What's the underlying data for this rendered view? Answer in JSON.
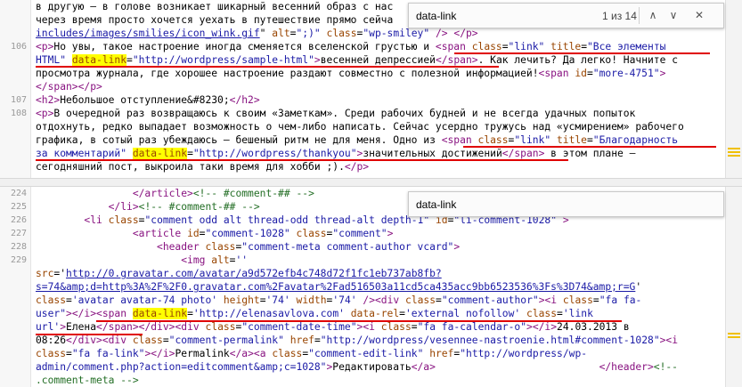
{
  "find_bar": {
    "query": "data-link",
    "count": "1 из 14",
    "prev_glyph": "∧",
    "next_glyph": "∨",
    "close_glyph": "✕"
  },
  "top_pane": {
    "lines": [
      {
        "ln": "",
        "html": "в другую — в голове возникает шикарный весенний образ с нас"
      },
      {
        "ln": "",
        "html": "через время просто хочется уехать в путешествие прямо сейча"
      },
      {
        "ln": "",
        "html": "<span class=\"au\">includes/images/smilies/icon_wink.gif</span>\" <span class=\"an\">alt</span>=<span class=\"av\">\";)\"</span> <span class=\"an\">class</span>=<span class=\"av\">\"wp-smiley\"</span> <span class=\"t\">/&gt; &lt;/p&gt;</span>"
      },
      {
        "ln": "106",
        "html": "<span class=\"t\">&lt;p&gt;</span>Но увы, такое настроение иногда сменяется вселенской грустью и <span class=\"t\">&lt;span</span> <span class=\"an\">class</span>=<span class=\"av\">\"link\"</span> <span class=\"an\">title</span>=<span class=\"av\">\"Все элементы</span>"
      },
      {
        "ln": "",
        "html": "<span class=\"av\">HTML\"</span> <span class=\"an hl\">data-link</span>=<span class=\"av\">\"http://wordpress/sample-html\"</span><span class=\"t\">&gt;</span>весенней депрессией<span class=\"t\">&lt;/span&gt;</span>. Как лечить? Да легко! Начните с"
      },
      {
        "ln": "",
        "html": "просмотра журнала, где хорошее настроение раздают совместно с полезной информацией!<span class=\"t\">&lt;span</span> <span class=\"an\">id</span>=<span class=\"av\">\"more-4751\"</span><span class=\"t\">&gt;</span>"
      },
      {
        "ln": "",
        "html": "<span class=\"t\">&lt;/span&gt;&lt;/p&gt;</span>"
      },
      {
        "ln": "107",
        "html": "<span class=\"t\">&lt;h2&gt;</span>Небольшое отступление&amp;#8230;<span class=\"t\">&lt;/h2&gt;</span>"
      },
      {
        "ln": "108",
        "html": "<span class=\"t\">&lt;p&gt;</span>В очередной раз возвращаюсь к своим «Заметкам». Среди рабочих будней и не всегда удачных попыток"
      },
      {
        "ln": "",
        "html": "отдохнуть, редко выпадает возможность о чем-либо написать. Сейчас усердно тружусь над «усмирением» рабочего"
      },
      {
        "ln": "",
        "html": "графика, в сотый раз убеждаюсь — бешеный ритм не для меня. Одно из <span class=\"t\">&lt;span</span> <span class=\"an\">class</span>=<span class=\"av\">\"link\"</span> <span class=\"an\">title</span>=<span class=\"av\">\"Благодарность</span>"
      },
      {
        "ln": "",
        "html": "<span class=\"av\">за комментарий\"</span> <span class=\"an hl\">data-link</span>=<span class=\"av\">\"http://wordpress/thankyou\"</span><span class=\"t\">&gt;</span>значительных достижений<span class=\"t\">&lt;/span&gt;</span> в этом плане —"
      },
      {
        "ln": "",
        "html": "сегодняшний пост, выкроила таки время для хобби ;).<span class=\"t\">&lt;/p&gt;</span>"
      }
    ]
  },
  "bottom_pane": {
    "lines": [
      {
        "ln": "224",
        "html": "                <span class=\"t\">&lt;/article&gt;</span><span class=\"cm\">&lt;!-- #comment-## --&gt;</span>"
      },
      {
        "ln": "225",
        "html": "            <span class=\"t\">&lt;/li&gt;</span><span class=\"cm\">&lt;!-- #comment-## --&gt;</span>"
      },
      {
        "ln": "226",
        "html": "        <span class=\"t\">&lt;li</span> <span class=\"an\">class</span>=<span class=\"av\">\"comment odd alt thread-odd thread-alt depth-1\"</span> <span class=\"an\">id</span>=<span class=\"av\">\"li-comment-1028\"</span> <span class=\"t\">&gt;</span>"
      },
      {
        "ln": "227",
        "html": "                <span class=\"t\">&lt;article</span> <span class=\"an\">id</span>=<span class=\"av\">\"comment-1028\"</span> <span class=\"an\">class</span>=<span class=\"av\">\"comment\"</span><span class=\"t\">&gt;</span>"
      },
      {
        "ln": "228",
        "html": "                    <span class=\"t\">&lt;header</span> <span class=\"an\">class</span>=<span class=\"av\">\"comment-meta comment-author vcard\"</span><span class=\"t\">&gt;</span>"
      },
      {
        "ln": "229",
        "html": "                        <span class=\"t\">&lt;img</span> <span class=\"an\">alt</span>=<span class=\"av\">''</span>"
      },
      {
        "ln": "",
        "html": "<span class=\"an\">src</span>='<span class=\"au\">http://0.gravatar.com/avatar/a9d572efb4c748d72f1fc1eb737ab8fb?</span>"
      },
      {
        "ln": "",
        "html": "<span class=\"au\">s=74&amp;amp;d=http%3A%2F%2F0.gravatar.com%2Favatar%2Fad516503a11cd5ca435acc9bb6523536%3Fs%3D74&amp;amp;r=G</span>'"
      },
      {
        "ln": "",
        "html": "<span class=\"an\">class</span>=<span class=\"av\">'avatar avatar-74 photo'</span> <span class=\"an\">height</span>=<span class=\"av\">'74'</span> <span class=\"an\">width</span>=<span class=\"av\">'74'</span> <span class=\"t\">/&gt;</span><span class=\"t\">&lt;div</span> <span class=\"an\">class</span>=<span class=\"av\">\"comment-author\"</span><span class=\"t\">&gt;&lt;i</span> <span class=\"an\">class</span>=<span class=\"av\">\"fa fa-</span>"
      },
      {
        "ln": "",
        "html": "<span class=\"av\">user\"</span><span class=\"t\">&gt;&lt;/i&gt;</span><span class=\"t\">&lt;span</span> <span class=\"an hl\">data-link</span>=<span class=\"av\">'http://elenasavlova.com'</span> <span class=\"an\">data-rel</span>=<span class=\"av\">'external nofollow'</span> <span class=\"an\">class</span>=<span class=\"av\">'link</span>"
      },
      {
        "ln": "",
        "html": "<span class=\"av\">url'</span><span class=\"t\">&gt;</span>Елена<span class=\"t\">&lt;/span&gt;</span><span class=\"t\">&lt;/div&gt;&lt;div</span> <span class=\"an\">class</span>=<span class=\"av\">\"comment-date-time\"</span><span class=\"t\">&gt;&lt;i</span> <span class=\"an\">class</span>=<span class=\"av\">\"fa fa-calendar-o\"</span><span class=\"t\">&gt;&lt;/i&gt;</span>24.03.2013 в"
      },
      {
        "ln": "",
        "html": "08:26<span class=\"t\">&lt;/div&gt;&lt;div</span> <span class=\"an\">class</span>=<span class=\"av\">\"comment-permalink\"</span> <span class=\"an\">href</span>=<span class=\"av\">\"http://wordpress/vesennee-nastroenie.html#comment-1028\"</span><span class=\"t\">&gt;&lt;i</span>"
      },
      {
        "ln": "",
        "html": "<span class=\"an\">class</span>=<span class=\"av\">\"fa fa-link\"</span><span class=\"t\">&gt;&lt;/i&gt;</span>Permalink<span class=\"t\">&lt;/a&gt;&lt;a</span> <span class=\"an\">class</span>=<span class=\"av\">\"comment-edit-link\"</span> <span class=\"an\">href</span>=<span class=\"av\">\"http://wordpress/wp-</span>"
      },
      {
        "ln": "",
        "html": "<span class=\"av\">admin/comment.php?action=editcomment&amp;amp;c=1028\"</span><span class=\"t\">&gt;</span>Редактировать<span class=\"t\">&lt;/a&gt;</span>                           <span class=\"t\">&lt;/header&gt;</span><span class=\"cm\">&lt;!--</span>"
      },
      {
        "ln": "",
        "html": "<span class=\"cm\">.comment-meta --&gt;</span>"
      }
    ]
  }
}
